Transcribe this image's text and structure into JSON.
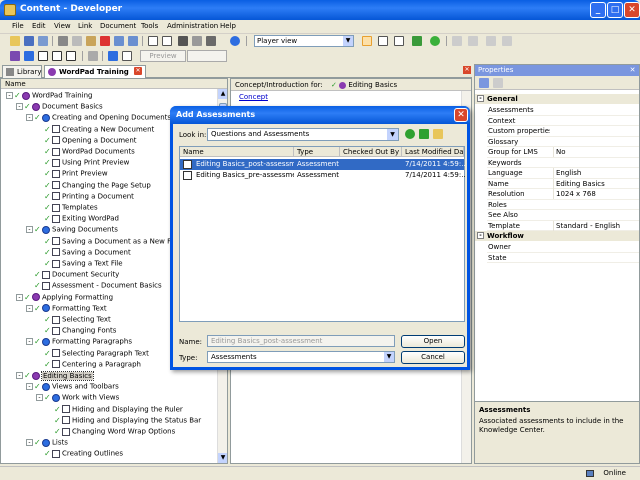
{
  "window": {
    "title": "Content - Developer"
  },
  "menu": [
    "File",
    "Edit",
    "View",
    "Link",
    "Document",
    "Tools",
    "Administration",
    "Help"
  ],
  "toolbar": {
    "view_select": "Player view",
    "preview_label": "Preview"
  },
  "tabs": [
    {
      "label": "Library"
    },
    {
      "label": "WordPad Training"
    }
  ],
  "outline": {
    "header": "Name",
    "items": [
      {
        "label": "WordPad Training",
        "level": 0,
        "kind": "module",
        "exp": "-"
      },
      {
        "label": "Document Basics",
        "level": 1,
        "kind": "module",
        "exp": "-"
      },
      {
        "label": "Creating and Opening Documents",
        "level": 2,
        "kind": "section",
        "exp": "-"
      },
      {
        "label": "Creating a New Document",
        "level": 3,
        "kind": "topic"
      },
      {
        "label": "Opening a Document",
        "level": 3,
        "kind": "topic"
      },
      {
        "label": "WordPad Documents",
        "level": 3,
        "kind": "topic"
      },
      {
        "label": "Using Print Preview",
        "level": 3,
        "kind": "topic"
      },
      {
        "label": "Print Preview",
        "level": 3,
        "kind": "topic"
      },
      {
        "label": "Changing the Page Setup",
        "level": 3,
        "kind": "topic"
      },
      {
        "label": "Printing a Document",
        "level": 3,
        "kind": "topic"
      },
      {
        "label": "Templates",
        "level": 3,
        "kind": "topic"
      },
      {
        "label": "Exiting WordPad",
        "level": 3,
        "kind": "topic"
      },
      {
        "label": "Saving Documents",
        "level": 2,
        "kind": "section",
        "exp": "-"
      },
      {
        "label": "Saving a Document as a New File",
        "level": 3,
        "kind": "topic"
      },
      {
        "label": "Saving a Document",
        "level": 3,
        "kind": "topic"
      },
      {
        "label": "Saving a Text File",
        "level": 3,
        "kind": "topic"
      },
      {
        "label": "Document Security",
        "level": 2,
        "kind": "topic"
      },
      {
        "label": "Assessment - Document Basics",
        "level": 2,
        "kind": "topic"
      },
      {
        "label": "Applying Formatting",
        "level": 1,
        "kind": "module",
        "exp": "-"
      },
      {
        "label": "Formatting Text",
        "level": 2,
        "kind": "section",
        "exp": "-"
      },
      {
        "label": "Selecting Text",
        "level": 3,
        "kind": "topic"
      },
      {
        "label": "Changing Fonts",
        "level": 3,
        "kind": "topic"
      },
      {
        "label": "Formatting Paragraphs",
        "level": 2,
        "kind": "section",
        "exp": "-"
      },
      {
        "label": "Selecting Paragraph Text",
        "level": 3,
        "kind": "topic"
      },
      {
        "label": "Centering a Paragraph",
        "level": 3,
        "kind": "topic"
      },
      {
        "label": "Editing Basics",
        "level": 1,
        "kind": "module",
        "exp": "-",
        "selected": true
      },
      {
        "label": "Views and Toolbars",
        "level": 2,
        "kind": "section",
        "exp": "-"
      },
      {
        "label": "Work with Views",
        "level": 3,
        "kind": "section",
        "exp": "-"
      },
      {
        "label": "Hiding and Displaying the Ruler",
        "level": 4,
        "kind": "topic"
      },
      {
        "label": "Hiding and Displaying the Status Bar",
        "level": 4,
        "kind": "topic"
      },
      {
        "label": "Changing Word Wrap Options",
        "level": 4,
        "kind": "topic"
      },
      {
        "label": "Lists",
        "level": 2,
        "kind": "section",
        "exp": "-"
      },
      {
        "label": "Creating Outlines",
        "level": 3,
        "kind": "topic"
      }
    ]
  },
  "concept": {
    "header": "Concept/Introduction for:",
    "target": "Editing Basics",
    "link": "Concept"
  },
  "properties": {
    "title": "Properties",
    "categories": [
      {
        "name": "General",
        "rows": [
          {
            "name": "Assessments",
            "value": ""
          },
          {
            "name": "Context",
            "value": ""
          },
          {
            "name": "Custom properties",
            "value": ""
          },
          {
            "name": "Glossary",
            "value": ""
          },
          {
            "name": "Group for LMS",
            "value": "No"
          },
          {
            "name": "Keywords",
            "value": ""
          },
          {
            "name": "Language",
            "value": "English"
          },
          {
            "name": "Name",
            "value": "Editing Basics"
          },
          {
            "name": "Resolution",
            "value": "1024 x 768"
          },
          {
            "name": "Roles",
            "value": ""
          },
          {
            "name": "See Also",
            "value": ""
          },
          {
            "name": "Template",
            "value": "Standard - English"
          }
        ]
      },
      {
        "name": "Workflow",
        "rows": [
          {
            "name": "Owner",
            "value": ""
          },
          {
            "name": "State",
            "value": ""
          }
        ]
      }
    ],
    "help_title": "Assessments",
    "help_text": "Associated assessments to include in the Knowledge Center."
  },
  "status": {
    "online": "Online"
  },
  "dialog": {
    "title": "Add Assessments",
    "lookin_label": "Look in:",
    "lookin_value": "Questions and Assessments",
    "columns": [
      "Name",
      "Type",
      "Checked Out By",
      "Last Modified Date"
    ],
    "files": [
      {
        "name": "Editing Basics_post-assessment",
        "type": "Assessment",
        "checked_out_by": "",
        "modified": "7/14/2011 4:59:...",
        "selected": true
      },
      {
        "name": "Editing Basics_pre-assessment",
        "type": "Assessment",
        "checked_out_by": "",
        "modified": "7/14/2011 4:59:..."
      }
    ],
    "name_label": "Name:",
    "name_value": "Editing Basics_post-assessment",
    "type_label": "Type:",
    "type_value": "Assessments",
    "open_label": "Open",
    "cancel_label": "Cancel"
  },
  "colors": {
    "titlebar": "#0a5fe3",
    "selection": "#316ac5",
    "check": "#2a9a2a"
  }
}
